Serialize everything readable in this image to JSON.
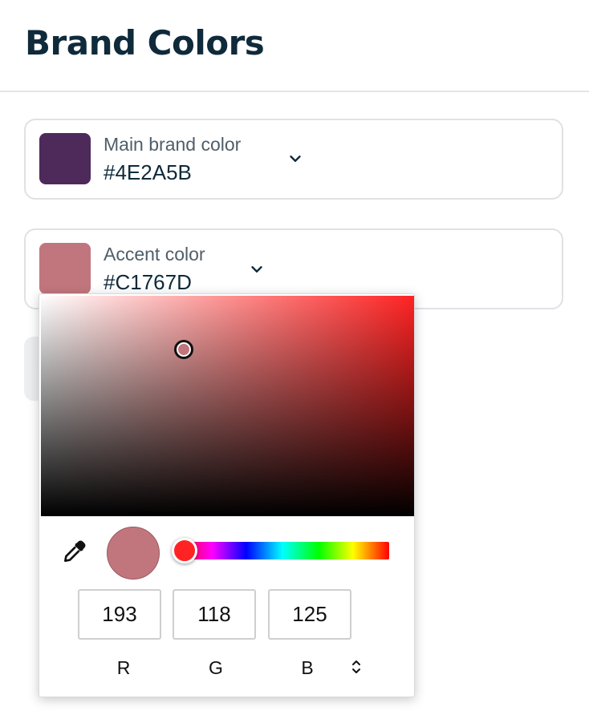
{
  "page": {
    "title": "Brand Colors"
  },
  "fields": {
    "main": {
      "label": "Main brand color",
      "value": "#4E2A5B",
      "swatch_color": "#4E2A5B"
    },
    "accent": {
      "label": "Accent color",
      "value": "#C1767D",
      "swatch_color": "#C1767D"
    }
  },
  "picker": {
    "hue_color": "#FF2323",
    "hue_level_percent": 0,
    "saturation_handle": {
      "saturation_percent": 39,
      "value_percent": 76
    },
    "preview_color": "#C1767D",
    "channels": [
      {
        "label": "R",
        "value": "193"
      },
      {
        "label": "G",
        "value": "118"
      },
      {
        "label": "B",
        "value": "125"
      }
    ]
  },
  "icons": {
    "chevron": "chevron-down-icon",
    "eyedropper": "eyedropper-icon",
    "mode_toggle": "up-down-arrows-icon"
  }
}
